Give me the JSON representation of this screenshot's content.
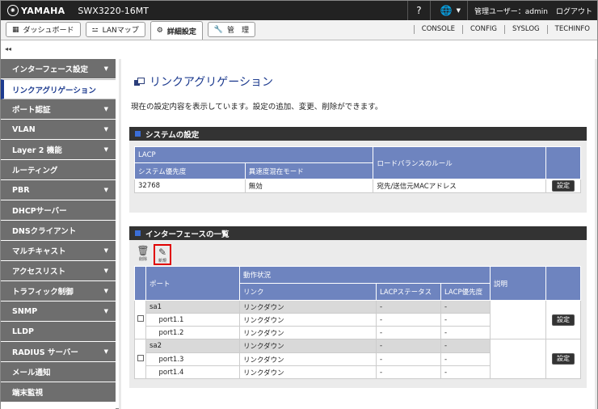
{
  "header": {
    "brand": "YAMAHA",
    "model": "SWX3220-16MT",
    "help": "?",
    "globe": "🌐",
    "user": "管理ユーザー：admin",
    "logout": "ログアウト"
  },
  "tabs": [
    {
      "icon": "▦",
      "label": "ダッシュボード"
    },
    {
      "icon": "⚍",
      "label": "LANマップ"
    },
    {
      "icon": "⚙",
      "label": "詳細設定"
    },
    {
      "icon": "🔧",
      "label": "管　理"
    }
  ],
  "links": [
    "CONSOLE",
    "CONFIG",
    "SYSLOG",
    "TECHINFO"
  ],
  "collapse": "◂◂",
  "sidebar": [
    {
      "label": "インターフェース設定",
      "arrow": "▼"
    },
    {
      "label": "リンクアグリゲーション",
      "arrow": ""
    },
    {
      "label": "ポート認証",
      "arrow": "▼"
    },
    {
      "label": "VLAN",
      "arrow": "▼"
    },
    {
      "label": "Layer 2 機能",
      "arrow": "▼"
    },
    {
      "label": "ルーティング",
      "arrow": ""
    },
    {
      "label": "PBR",
      "arrow": "▼"
    },
    {
      "label": "DHCPサーバー",
      "arrow": ""
    },
    {
      "label": "DNSクライアント",
      "arrow": ""
    },
    {
      "label": "マルチキャスト",
      "arrow": "▼"
    },
    {
      "label": "アクセスリスト",
      "arrow": "▼"
    },
    {
      "label": "トラフィック制御",
      "arrow": "▼"
    },
    {
      "label": "SNMP",
      "arrow": "▼"
    },
    {
      "label": "LLDP",
      "arrow": ""
    },
    {
      "label": "RADIUS サーバー",
      "arrow": "▼"
    },
    {
      "label": "メール通知",
      "arrow": ""
    },
    {
      "label": "端末監視",
      "arrow": ""
    }
  ],
  "page": {
    "title": "リンクアグリゲーション",
    "description": "現在の設定内容を表示しています。設定の追加、変更、削除ができます。"
  },
  "system": {
    "heading": "システムの設定",
    "lacp": "LACP",
    "col_priority": "システム優先度",
    "col_mixed": "異速度混在モード",
    "col_lb": "ロードバランスのルール",
    "priority": "32768",
    "mixed": "無効",
    "lb": "宛先/送信元MACアドレス",
    "set": "設定"
  },
  "ifs": {
    "heading": "インターフェースの一覧",
    "delete_icon": "🗑",
    "delete_label": "削除",
    "new_icon": "✎",
    "new_label": "新規",
    "col_port": "ポート",
    "col_status": "動作状況",
    "col_link": "リンク",
    "col_lacp_status": "LACPステータス",
    "col_lacp_priority": "LACP優先度",
    "col_desc": "説明",
    "set": "設定",
    "groups": [
      {
        "name": "sa1",
        "link": "リンクダウン",
        "lacp_status": "-",
        "lacp_priority": "-",
        "ports": [
          {
            "name": "port1.1",
            "link": "リンクダウン",
            "lacp_status": "-",
            "lacp_priority": "-"
          },
          {
            "name": "port1.2",
            "link": "リンクダウン",
            "lacp_status": "-",
            "lacp_priority": "-"
          }
        ]
      },
      {
        "name": "sa2",
        "link": "リンクダウン",
        "lacp_status": "-",
        "lacp_priority": "-",
        "ports": [
          {
            "name": "port1.3",
            "link": "リンクダウン",
            "lacp_status": "-",
            "lacp_priority": "-"
          },
          {
            "name": "port1.4",
            "link": "リンクダウン",
            "lacp_status": "-",
            "lacp_priority": "-"
          }
        ]
      }
    ]
  }
}
